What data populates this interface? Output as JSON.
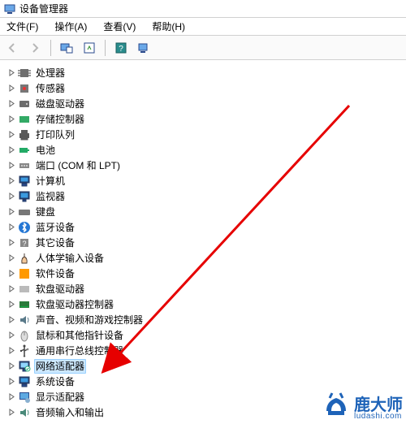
{
  "window": {
    "title": "设备管理器"
  },
  "menu": {
    "file": "文件(F)",
    "action": "操作(A)",
    "view": "查看(V)",
    "help": "帮助(H)"
  },
  "toolbar": {
    "back": "后退",
    "forward": "前进",
    "show_hidden": "显示隐藏的设备",
    "refresh": "刷新",
    "help": "帮助",
    "properties": "属性"
  },
  "tree": {
    "items": [
      {
        "label": "处理器",
        "icon": "cpu-icon"
      },
      {
        "label": "传感器",
        "icon": "sensor-icon"
      },
      {
        "label": "磁盘驱动器",
        "icon": "disk-icon"
      },
      {
        "label": "存储控制器",
        "icon": "storage-controller-icon"
      },
      {
        "label": "打印队列",
        "icon": "printer-icon"
      },
      {
        "label": "电池",
        "icon": "battery-icon"
      },
      {
        "label": "端口 (COM 和 LPT)",
        "icon": "port-icon"
      },
      {
        "label": "计算机",
        "icon": "computer-icon"
      },
      {
        "label": "监视器",
        "icon": "monitor-icon"
      },
      {
        "label": "键盘",
        "icon": "keyboard-icon"
      },
      {
        "label": "蓝牙设备",
        "icon": "bluetooth-icon"
      },
      {
        "label": "其它设备",
        "icon": "other-device-icon"
      },
      {
        "label": "人体学输入设备",
        "icon": "hid-icon"
      },
      {
        "label": "软件设备",
        "icon": "software-icon"
      },
      {
        "label": "软盘驱动器",
        "icon": "floppy-drive-icon"
      },
      {
        "label": "软盘驱动器控制器",
        "icon": "floppy-controller-icon"
      },
      {
        "label": "声音、视频和游戏控制器",
        "icon": "sound-icon"
      },
      {
        "label": "鼠标和其他指针设备",
        "icon": "mouse-icon"
      },
      {
        "label": "通用串行总线控制器",
        "icon": "usb-icon"
      },
      {
        "label": "网络适配器",
        "icon": "network-adapter-icon",
        "selected": true
      },
      {
        "label": "系统设备",
        "icon": "system-icon"
      },
      {
        "label": "显示适配器",
        "icon": "display-adapter-icon"
      },
      {
        "label": "音频输入和输出",
        "icon": "audio-io-icon"
      }
    ]
  },
  "watermark": {
    "brand": "鹿大师",
    "url": "ludashi.com"
  }
}
